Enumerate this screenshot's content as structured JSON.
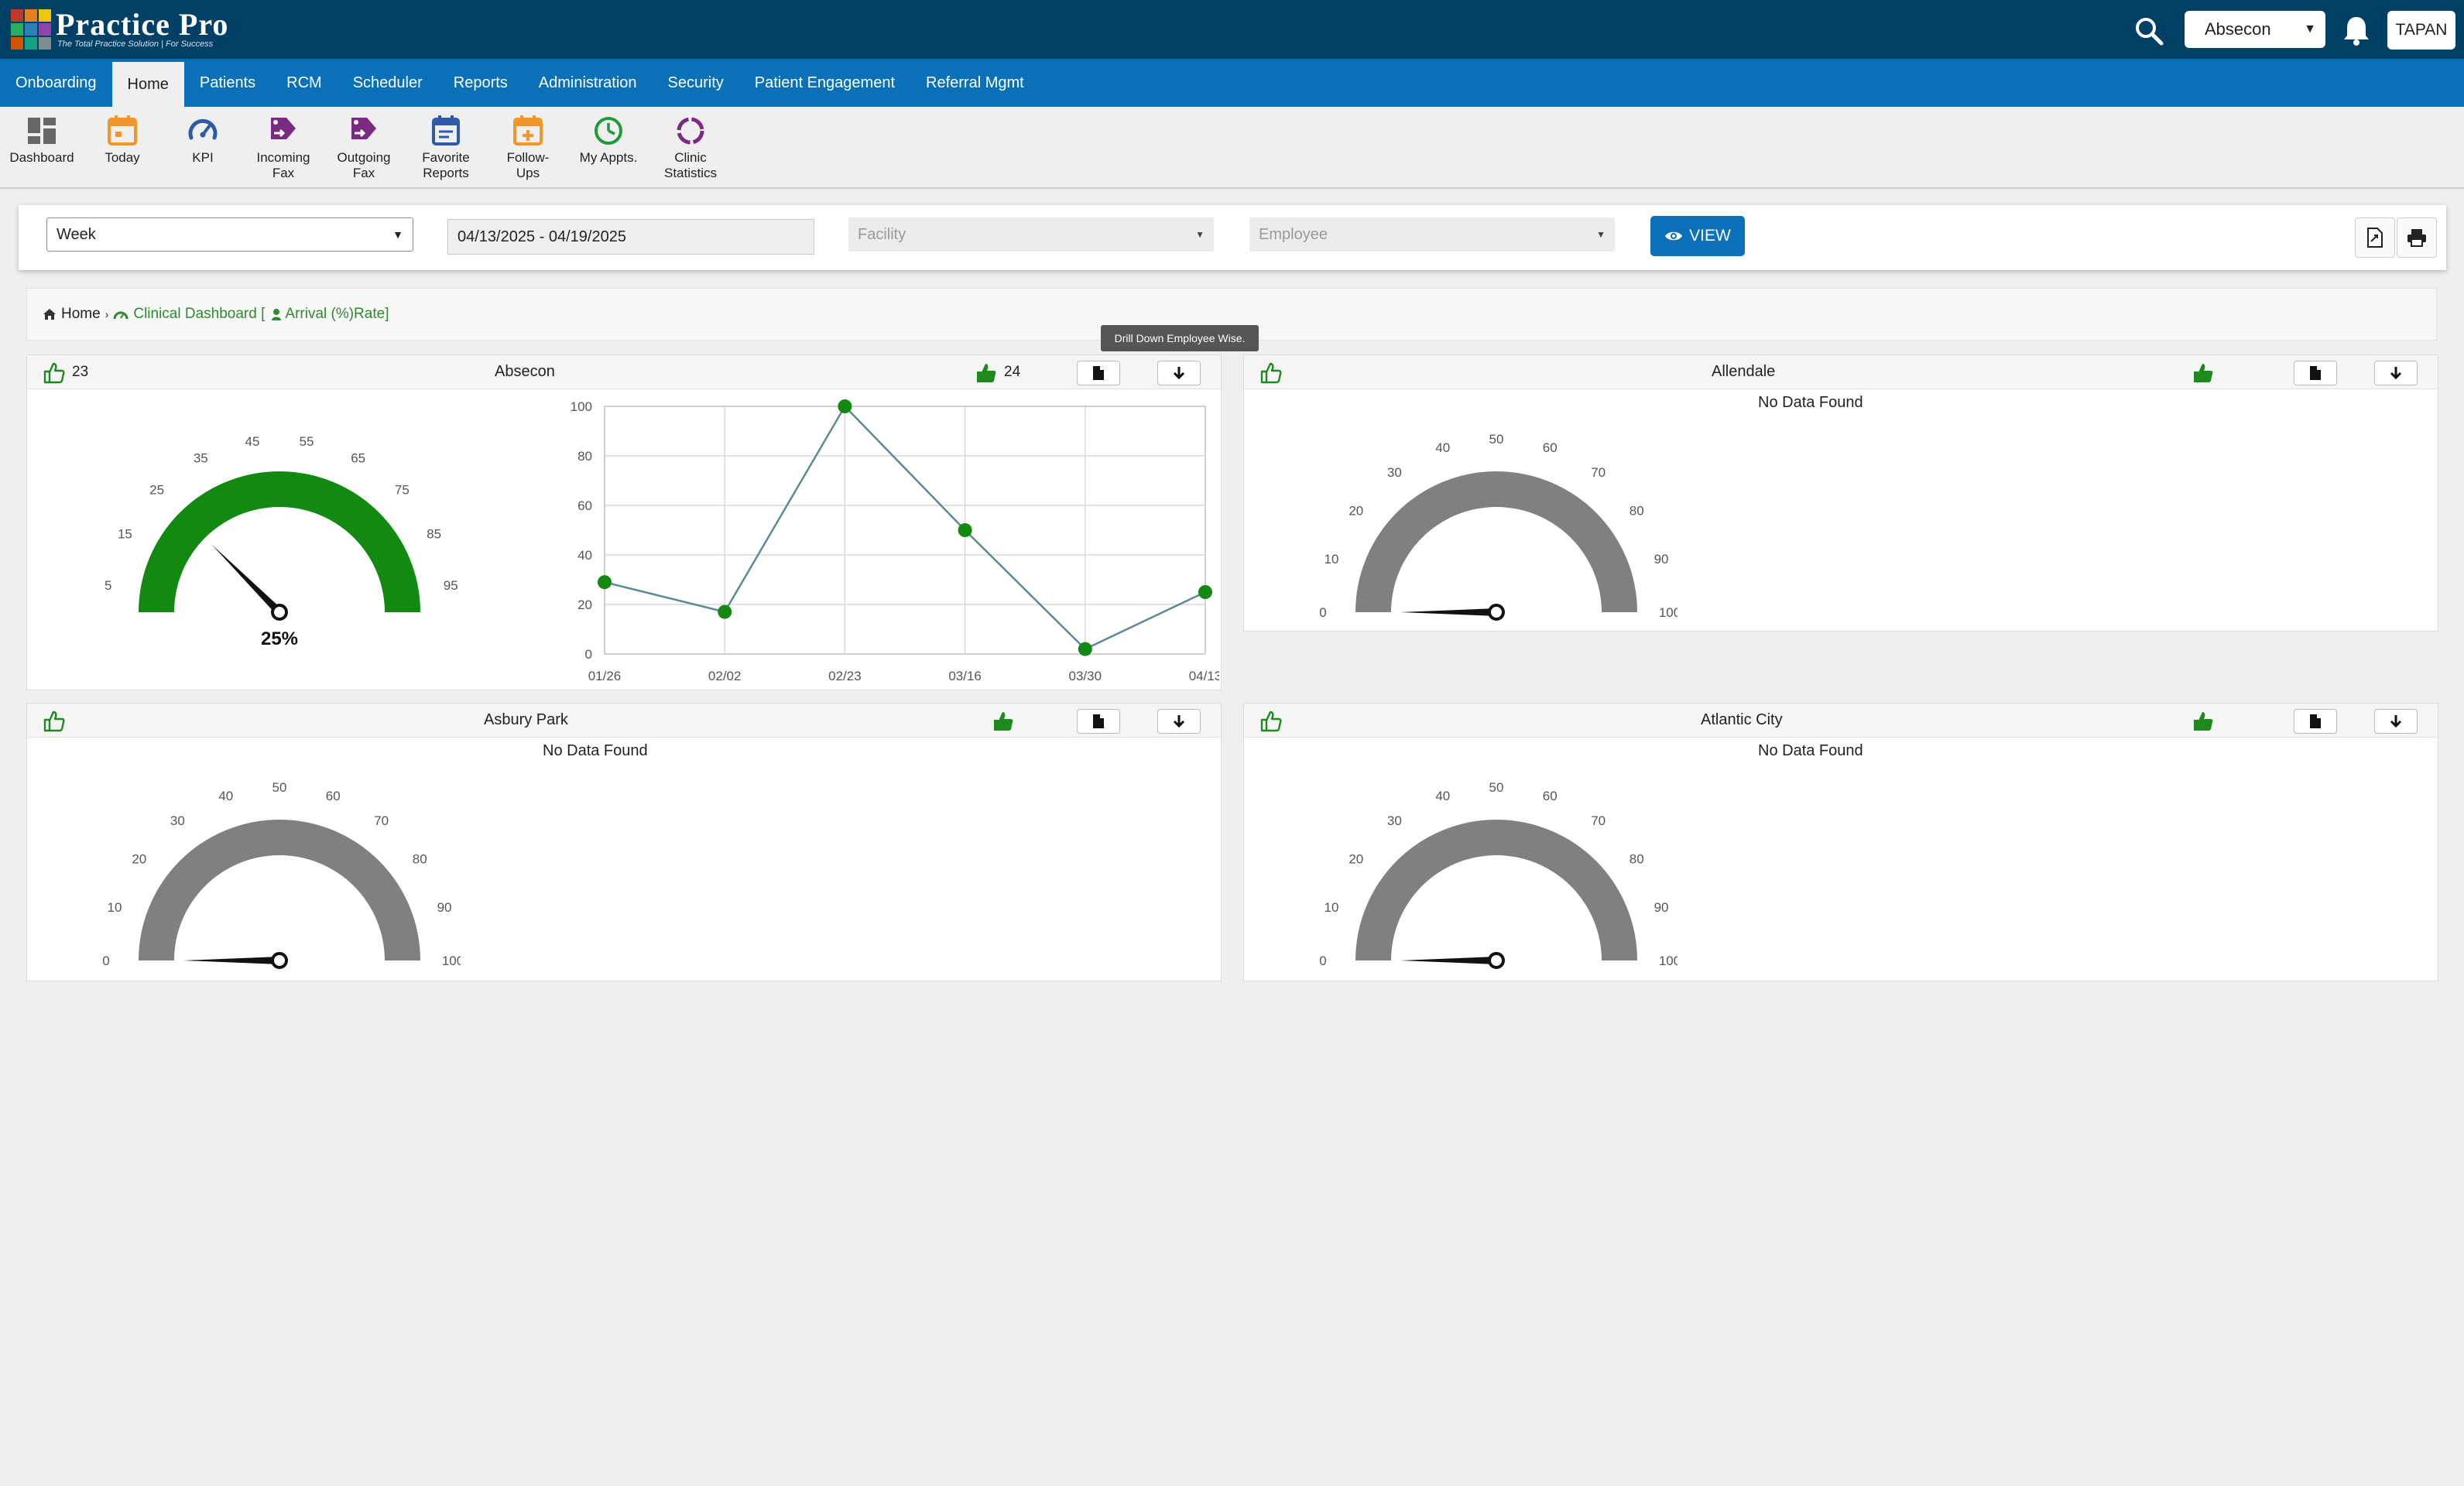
{
  "app": {
    "logo_title": "Practice Pro",
    "logo_tagline": "The Total Practice Solution | For Success",
    "location_select": "Absecon",
    "user": "TAPAN"
  },
  "nav": {
    "items": [
      "Onboarding",
      "Home",
      "Patients",
      "RCM",
      "Scheduler",
      "Reports",
      "Administration",
      "Security",
      "Patient Engagement",
      "Referral Mgmt"
    ],
    "active": "Home"
  },
  "toolbar": {
    "dashboard": "Dashboard",
    "today": "Today",
    "kpi": "KPI",
    "incoming_fax_1": "Incoming",
    "incoming_fax_2": "Fax",
    "outgoing_fax_1": "Outgoing",
    "outgoing_fax_2": "Fax",
    "favorite_reports_1": "Favorite",
    "favorite_reports_2": "Reports",
    "follow_ups_1": "Follow-",
    "follow_ups_2": "Ups",
    "my_appts": "My Appts.",
    "clinic_statistics_1": "Clinic",
    "clinic_statistics_2": "Statistics"
  },
  "filters": {
    "period": "Week",
    "date_range": "04/13/2025 - 04/19/2025",
    "facility_placeholder": "Facility",
    "employee_placeholder": "Employee",
    "view_label": "VIEW"
  },
  "breadcrumb": {
    "home": "Home",
    "dashboard": "Clinical Dashboard [",
    "metric": "Arrival (%)Rate]"
  },
  "tooltip": "Drill Down Employee Wise.",
  "colors": {
    "topbar": "#004066",
    "nav": "#0a71b8",
    "gauge_fill": "#128a12",
    "gauge_empty": "#808080",
    "line": "#5b8a92",
    "point": "#128a12"
  },
  "panels": {
    "absecon": {
      "title": "Absecon",
      "count_left": "23",
      "count_right": "24",
      "gauge_value": "25%",
      "gauge_ticks": [
        "5",
        "15",
        "25",
        "35",
        "45",
        "55",
        "65",
        "75",
        "85",
        "95"
      ]
    },
    "allendale": {
      "title": "Allendale",
      "no_data": "No Data Found",
      "gauge_value": "0%",
      "gauge_ticks": [
        "0",
        "10",
        "20",
        "30",
        "40",
        "50",
        "60",
        "70",
        "80",
        "90",
        "100"
      ]
    },
    "asbury_park": {
      "title": "Asbury Park",
      "no_data": "No Data Found",
      "gauge_value": "0%",
      "gauge_ticks": [
        "0",
        "10",
        "20",
        "30",
        "40",
        "50",
        "60",
        "70",
        "80",
        "90",
        "100"
      ]
    },
    "atlantic_city": {
      "title": "Atlantic City",
      "no_data": "No Data Found",
      "gauge_value": "0%",
      "gauge_ticks": [
        "0",
        "10",
        "20",
        "30",
        "40",
        "50",
        "60",
        "70",
        "80",
        "90",
        "100"
      ]
    }
  },
  "chart_data": {
    "type": "line",
    "title": "",
    "xlabel": "",
    "ylabel": "",
    "categories": [
      "01/26",
      "02/02",
      "02/23",
      "03/16",
      "03/30",
      "04/13"
    ],
    "values": [
      29,
      17,
      100,
      50,
      2,
      25
    ],
    "ylim": [
      0,
      100
    ],
    "yticks": [
      "0",
      "20",
      "40",
      "60",
      "80",
      "100"
    ],
    "grid": true
  }
}
